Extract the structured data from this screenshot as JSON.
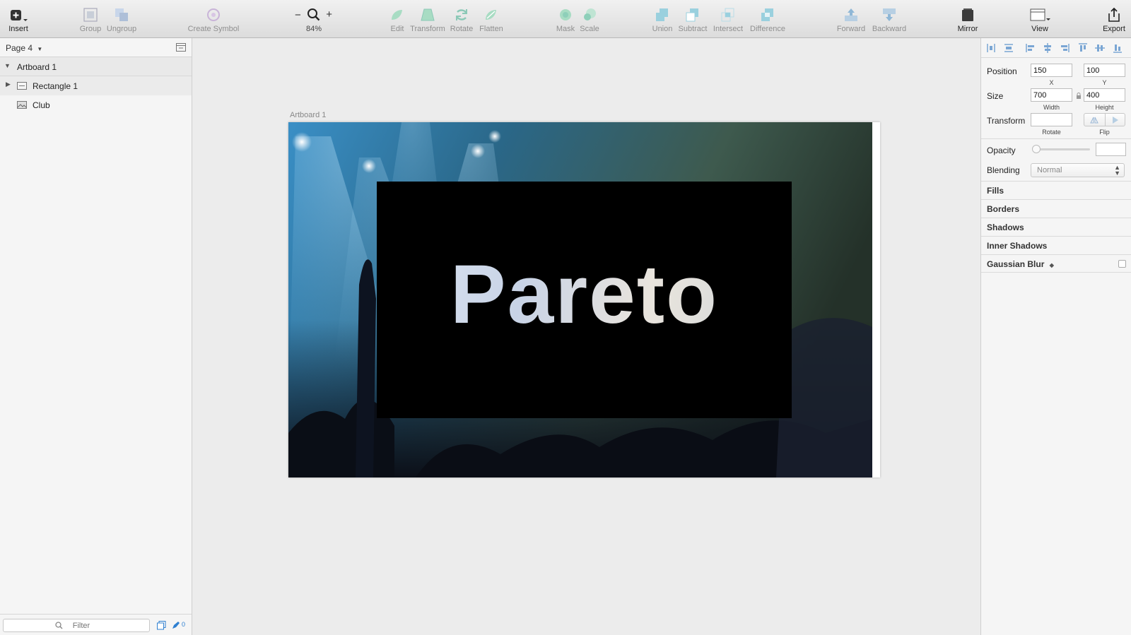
{
  "toolbar": {
    "insert": "Insert",
    "group": "Group",
    "ungroup": "Ungroup",
    "create_symbol": "Create Symbol",
    "zoom_level": "84%",
    "zoom_minus": "−",
    "zoom_plus": "+",
    "edit": "Edit",
    "transform": "Transform",
    "rotate": "Rotate",
    "flatten": "Flatten",
    "mask": "Mask",
    "scale": "Scale",
    "union": "Union",
    "subtract": "Subtract",
    "intersect": "Intersect",
    "difference": "Difference",
    "forward": "Forward",
    "backward": "Backward",
    "mirror": "Mirror",
    "view": "View",
    "export": "Export"
  },
  "layers": {
    "page": "Page 4",
    "items": [
      "Artboard 1",
      "Rectangle 1",
      "Club"
    ],
    "filter_placeholder": "Filter",
    "edit_count": "0"
  },
  "canvas": {
    "artboard_label": "Artboard 1",
    "text": "Pareto"
  },
  "inspector": {
    "position_label": "Position",
    "x": "150",
    "y": "100",
    "x_label": "X",
    "y_label": "Y",
    "size_label": "Size",
    "width": "700",
    "height": "400",
    "width_label": "Width",
    "height_label": "Height",
    "transform_label": "Transform",
    "rotate_label": "Rotate",
    "flip_label": "Flip",
    "opacity_label": "Opacity",
    "blending_label": "Blending",
    "blending_value": "Normal",
    "sections": [
      "Fills",
      "Borders",
      "Shadows",
      "Inner Shadows",
      "Gaussian Blur"
    ]
  },
  "colors": {
    "accent_icon": "#8cc9b7",
    "boolean_icon": "#9ad0de",
    "arrange_icon": "#8fb7d6"
  }
}
